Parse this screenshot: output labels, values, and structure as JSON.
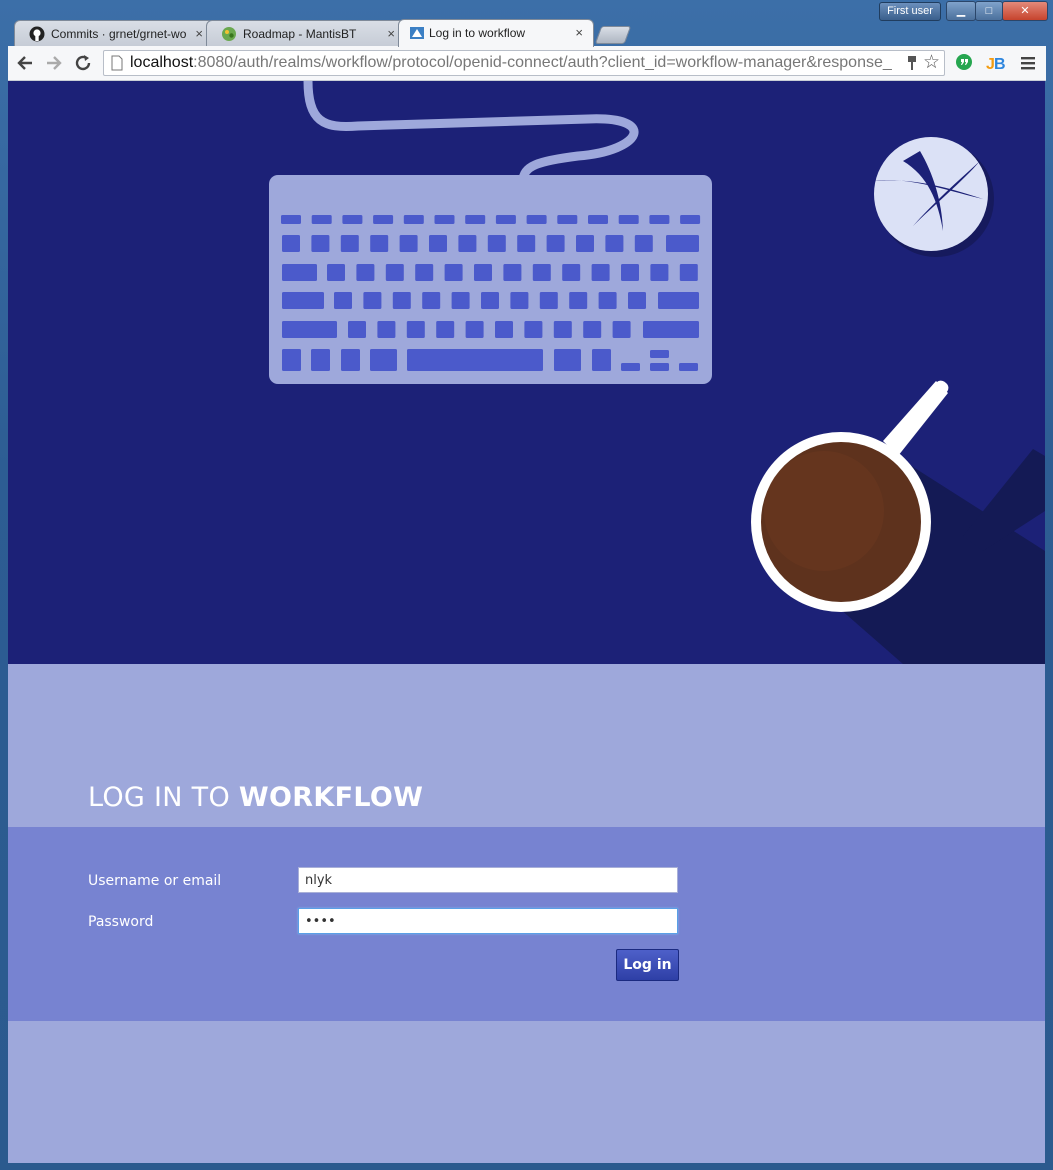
{
  "browser": {
    "user_label": "First user",
    "tabs": [
      {
        "title": "Commits · grnet/grnet-wo",
        "close": "×",
        "icon": "github-icon"
      },
      {
        "title": "Roadmap - MantisBT",
        "close": "×",
        "icon": "mantisbt-icon"
      },
      {
        "title": "Log in to workflow",
        "close": "×",
        "icon": "keycloak-icon",
        "active": true
      }
    ],
    "url": {
      "host": "localhost",
      "rest": ":8080/auth/realms/workflow/protocol/openid-connect/auth?client_id=workflow-manager&response_"
    },
    "window_controls": {
      "minimize": "▁",
      "maximize": "□",
      "close": "✕"
    }
  },
  "page": {
    "title_prefix": "LOG IN TO ",
    "title_strong": "WORKFLOW",
    "form": {
      "username_label": "Username or email",
      "username_value": "nlyk",
      "password_label": "Password",
      "password_value": "••••",
      "submit_label": "Log in"
    }
  },
  "colors": {
    "hero_bg": "#1c2177",
    "header_bg": "#9ea8db",
    "form_bg": "#7783d1",
    "button": "#3a4bb5"
  }
}
